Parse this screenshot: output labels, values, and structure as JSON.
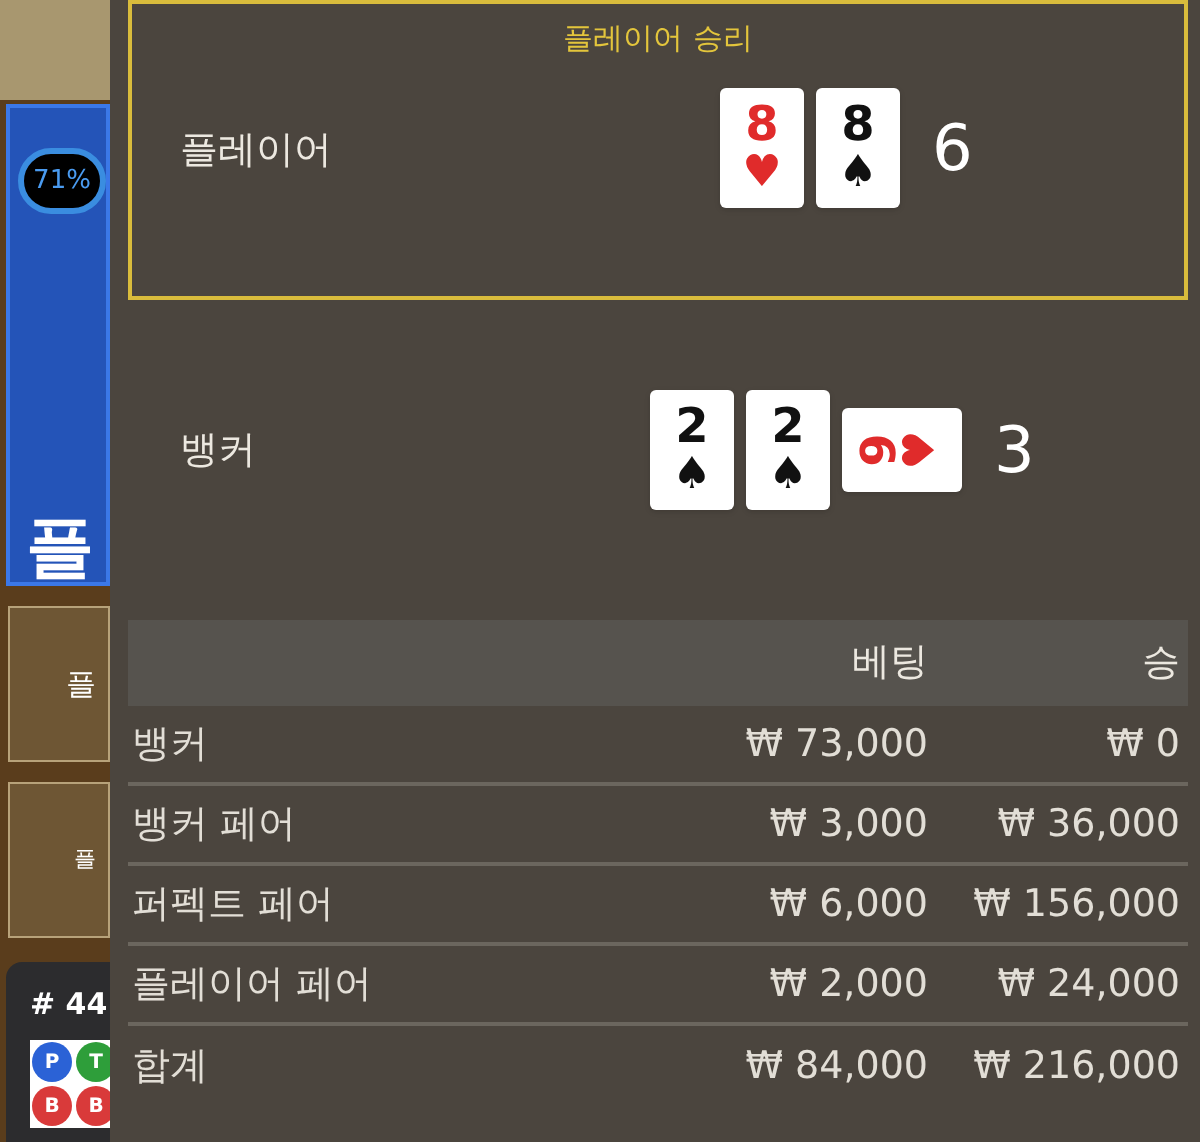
{
  "background": {
    "percent": "71%",
    "side_label": "플",
    "buttons": [
      "플",
      "플"
    ],
    "round": "# 44",
    "road": [
      {
        "label": "P",
        "color": "#2b62d6"
      },
      {
        "label": "T",
        "color": "#2e9e3a"
      },
      {
        "label": "B",
        "color": "#d93a3a"
      },
      {
        "label": "B",
        "color": "#d93a3a"
      }
    ]
  },
  "result": {
    "title": "플레이어 승리",
    "hands": [
      {
        "name": "플레이어",
        "winner": true,
        "score": "6",
        "cards": [
          {
            "rank": "8",
            "suit": "♥",
            "color": "#e02b2b",
            "rotated": false
          },
          {
            "rank": "8",
            "suit": "♠",
            "color": "#111111",
            "rotated": false
          }
        ]
      },
      {
        "name": "뱅커",
        "winner": false,
        "score": "3",
        "cards": [
          {
            "rank": "2",
            "suit": "♠",
            "color": "#111111",
            "rotated": false
          },
          {
            "rank": "2",
            "suit": "♠",
            "color": "#111111",
            "rotated": false
          },
          {
            "rank": "9",
            "suit": "♥",
            "color": "#e02b2b",
            "rotated": true
          }
        ]
      }
    ]
  },
  "table": {
    "columns": [
      "베팅",
      "승"
    ],
    "rows": [
      {
        "name": "뱅커",
        "bet": "₩ 73,000",
        "win": "₩ 0"
      },
      {
        "name": "뱅커 페어",
        "bet": "₩ 3,000",
        "win": "₩ 36,000"
      },
      {
        "name": "퍼펙트 페어",
        "bet": "₩ 6,000",
        "win": "₩ 156,000"
      },
      {
        "name": "플레이어 페어",
        "bet": "₩ 2,000",
        "win": "₩ 24,000"
      },
      {
        "name": "합계",
        "bet": "₩ 84,000",
        "win": "₩ 216,000"
      }
    ]
  }
}
